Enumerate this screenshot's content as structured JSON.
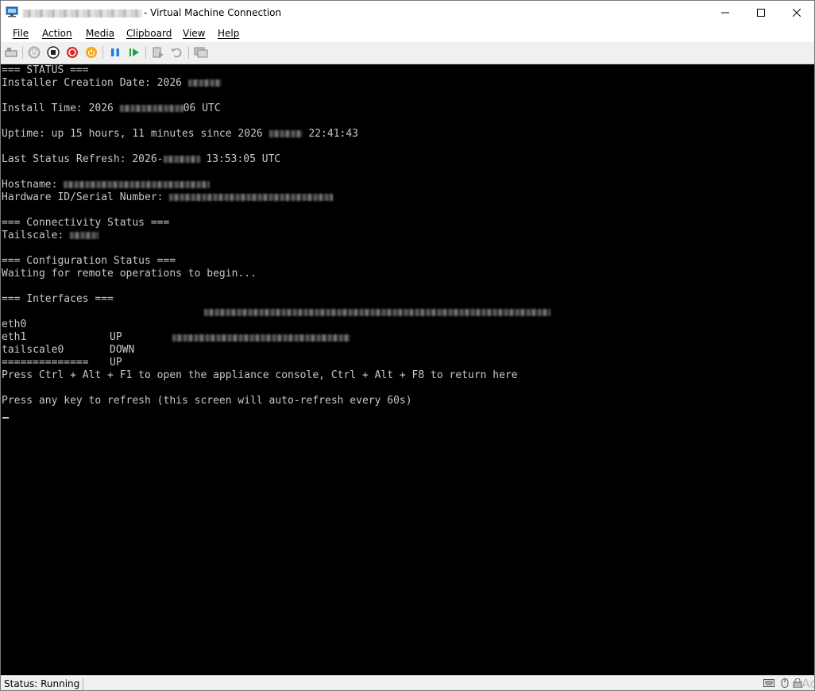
{
  "window": {
    "title": "- Virtual Machine Connection"
  },
  "menu": {
    "file": "File",
    "action": "Action",
    "media": "Media",
    "clipboard": "Clipboard",
    "view": "View",
    "help": "Help"
  },
  "toolbar": {
    "buttons": [
      "ctrl-alt-del",
      "start",
      "turn-off",
      "shut-down",
      "save",
      "pause",
      "resume",
      "checkpoint",
      "revert",
      "enhanced-session"
    ]
  },
  "console": {
    "lines": [
      "=== STATUS ===",
      "Installer Creation Date: 2026",
      "",
      "Install Time: 2026",
      "06 UTC",
      "Uptime: up 15 hours, 11 minutes since 2026",
      "22:41:43",
      "Last Status Refresh: 2026-",
      "13:53:05 UTC",
      "Hostname:",
      "Hardware ID/Serial Number:",
      "=== Connectivity Status ===",
      "Tailscale:",
      "=== Configuration Status ===",
      "Waiting for remote operations to begin...",
      "=== Interfaces ===",
      "==============",
      "Press Ctrl + Alt + F1 to open the appliance console, Ctrl + Alt + F8 to return here",
      "Press any key to refresh (this screen will auto-refresh every 60s)"
    ],
    "interfaces": [
      {
        "name": "eth0",
        "state": "UP"
      },
      {
        "name": "eth1",
        "state": "DOWN"
      },
      {
        "name": "tailscale0",
        "state": "UP"
      }
    ]
  },
  "status": {
    "text": "Status: Running"
  },
  "watermark": "Act",
  "colors": {
    "console_bg": "#000000",
    "console_fg": "#c8c8c8",
    "toolbar_bg": "#f0f0f0"
  }
}
